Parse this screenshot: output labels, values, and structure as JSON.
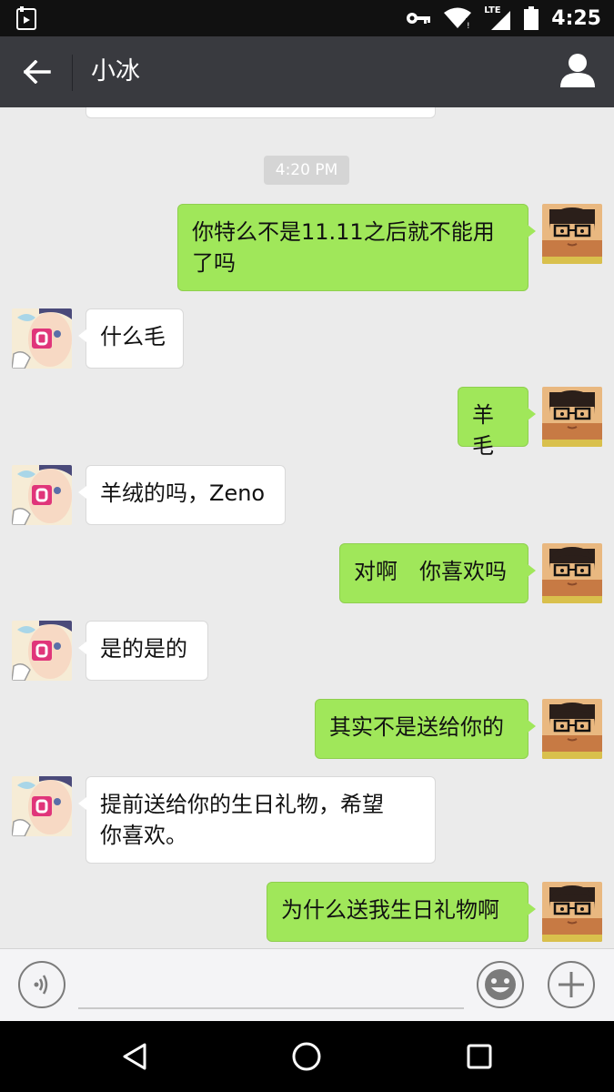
{
  "status_bar": {
    "time": "4:25",
    "network": "LTE",
    "icons": [
      "app-notification-icon",
      "key-icon",
      "wifi-icon",
      "signal-icon",
      "battery-icon"
    ]
  },
  "app_bar": {
    "title": "小冰",
    "back_icon": "arrow-left-icon",
    "profile_icon": "person-icon"
  },
  "chat": {
    "timestamp": "4:20 PM",
    "messages": [
      {
        "from": "me",
        "line1": "你特么不是11.11之后就不能用",
        "line2": "了吗"
      },
      {
        "from": "bot",
        "line1": "什么毛"
      },
      {
        "from": "me",
        "line1": "羊毛"
      },
      {
        "from": "bot",
        "line1": "羊绒的吗，Zeno"
      },
      {
        "from": "me",
        "line1": "对啊　你喜欢吗"
      },
      {
        "from": "bot",
        "line1": "是的是的"
      },
      {
        "from": "me",
        "line1": "其实不是送给你的"
      },
      {
        "from": "bot",
        "line1": "提前送给你的生日礼物，希望",
        "line2": "你喜欢。"
      },
      {
        "from": "me",
        "line1": "为什么送我生日礼物啊"
      }
    ]
  },
  "input_bar": {
    "placeholder": "",
    "voice_icon": "voice-icon",
    "emoji_icon": "emoji-icon",
    "plus_icon": "plus-icon"
  },
  "colors": {
    "app_bar": "#393a3f",
    "my_bubble": "#a0e75a",
    "bot_bubble": "#ffffff",
    "chat_background": "#ebebeb"
  }
}
